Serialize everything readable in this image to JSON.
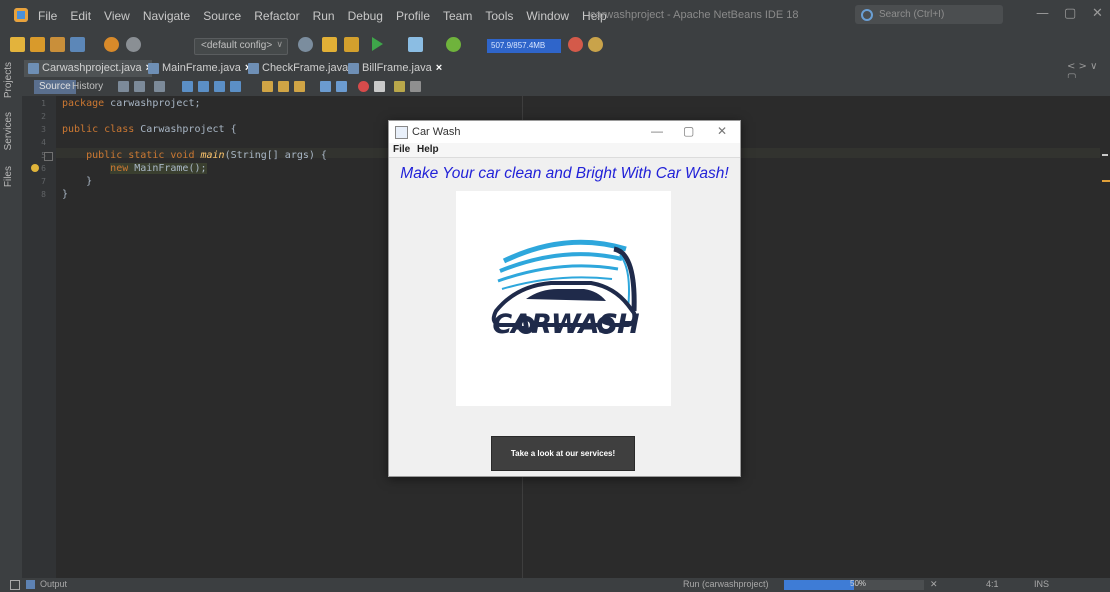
{
  "ide": {
    "menu": [
      "File",
      "Edit",
      "View",
      "Navigate",
      "Source",
      "Refactor",
      "Run",
      "Debug",
      "Profile",
      "Team",
      "Tools",
      "Window",
      "Help"
    ],
    "window_title": "carwashproject - Apache NetBeans IDE 18",
    "search_placeholder": "Search (Ctrl+I)",
    "window_controls": {
      "minimize": "—",
      "maximize": "▢",
      "close": "✕"
    },
    "config_select": "<default config>",
    "memory_label": "507.9/857.4MB",
    "side_panels": [
      "Projects",
      "Services",
      "Files"
    ],
    "tabs": [
      {
        "label": "Carwashproject.java",
        "active": true
      },
      {
        "label": "MainFrame.java",
        "active": false
      },
      {
        "label": "CheckFrame.java",
        "active": false
      },
      {
        "label": "BillFrame.java",
        "active": false
      }
    ],
    "tab_close": "×",
    "tab_nav": "< > ∨ ▢",
    "editor_buttons": {
      "source": "Source",
      "history": "History"
    },
    "code_lines": [
      {
        "n": "1",
        "text": "package carwashproject;"
      },
      {
        "n": "2",
        "text": ""
      },
      {
        "n": "3",
        "text": "public class Carwashproject {"
      },
      {
        "n": "4",
        "text": ""
      },
      {
        "n": "5",
        "text": "    public static void main(String[] args) {"
      },
      {
        "n": "6",
        "text": "        new MainFrame();"
      },
      {
        "n": "7",
        "text": "    }"
      },
      {
        "n": "8",
        "text": "}"
      }
    ]
  },
  "statusbar": {
    "output_label": "Output",
    "run_label": "Run (carwashproject)",
    "progress_percent": 50,
    "progress_text": "50%",
    "cancel": "✕",
    "position": "4:1",
    "mode": "INS"
  },
  "dialog": {
    "title": "Car Wash",
    "controls": {
      "minimize": "—",
      "maximize": "▢",
      "close": "✕"
    },
    "menu": [
      "File",
      "Help"
    ],
    "headline": "Make Your car clean and Bright With Car Wash!",
    "logo_text": "CARWASH",
    "button_label": "Take a look at our services!"
  },
  "colors": {
    "ide_bg": "#2b2b2b",
    "panel_bg": "#3c3f41",
    "headline_blue": "#2222d8",
    "logo_navy": "#1f2a4a",
    "logo_cyan": "#2ea7dc",
    "button_dark": "#3f3f3f"
  }
}
